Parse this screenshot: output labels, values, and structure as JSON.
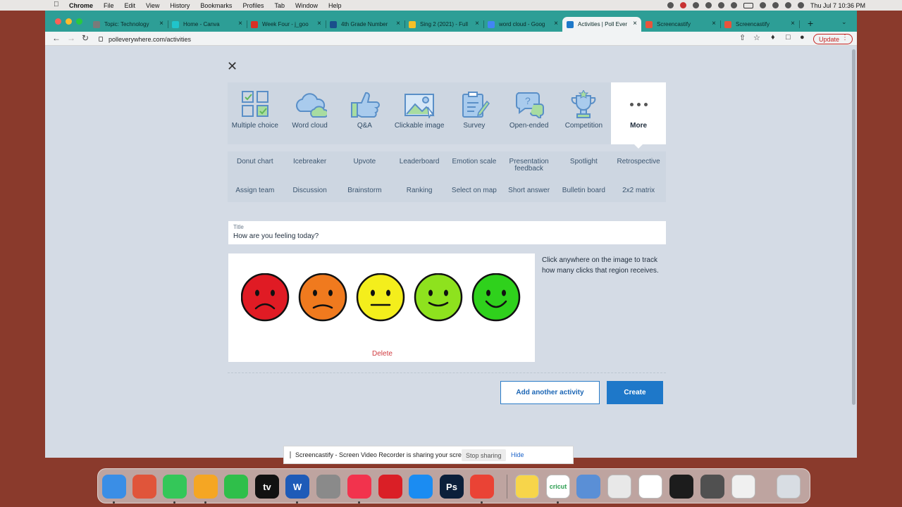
{
  "menubar": {
    "menus": [
      "Chrome",
      "File",
      "Edit",
      "View",
      "History",
      "Bookmarks",
      "Profiles",
      "Tab",
      "Window",
      "Help"
    ],
    "clock": "Thu Jul 7  10:36 PM"
  },
  "browser": {
    "tabs": [
      {
        "title": "Topic: Technology",
        "favicon_color": "#7a7a7a"
      },
      {
        "title": "Home - Canva",
        "favicon_color": "#20c4cb"
      },
      {
        "title": "Week Four - j_goo",
        "favicon_color": "#d93025"
      },
      {
        "title": "4th Grade Number",
        "favicon_color": "#1a4f8b"
      },
      {
        "title": "Sing 2 (2021) - Full",
        "favicon_color": "#f6c026"
      },
      {
        "title": "word cloud - Goog",
        "favicon_color": "#4285f4"
      },
      {
        "title": "Activities | Poll Ever",
        "favicon_color": "#1e78c9"
      },
      {
        "title": "Screencastify",
        "favicon_color": "#e8543c"
      },
      {
        "title": "Screencastify",
        "favicon_color": "#e8543c"
      }
    ],
    "url": "polleverywhere.com/activities",
    "update_label": "Update"
  },
  "activity_types": [
    {
      "label": "Multiple choice",
      "icon": "multiple-choice-icon"
    },
    {
      "label": "Word cloud",
      "icon": "word-cloud-icon"
    },
    {
      "label": "Q&A",
      "icon": "thumbs-up-icon"
    },
    {
      "label": "Clickable image",
      "icon": "clickable-image-icon"
    },
    {
      "label": "Survey",
      "icon": "clipboard-icon"
    },
    {
      "label": "Open-ended",
      "icon": "speech-bubbles-icon"
    },
    {
      "label": "Competition",
      "icon": "trophy-icon"
    },
    {
      "label": "More",
      "icon": "more-dots-icon"
    }
  ],
  "more_types": [
    "Donut chart",
    "Icebreaker",
    "Upvote",
    "Leaderboard",
    "Emotion scale",
    "Presentation feedback",
    "Spotlight",
    "Retrospective",
    "Assign team",
    "Discussion",
    "Brainstorm",
    "Ranking",
    "Select on map",
    "Short answer",
    "Bulletin board",
    "2x2 matrix"
  ],
  "form": {
    "title_label": "Title",
    "title_value": "How are you feeling today?",
    "delete_label": "Delete",
    "hint": "Click anywhere on the image to track how many clicks that region receives."
  },
  "emotion_faces": [
    {
      "color": "#e01b24",
      "mood": "sad"
    },
    {
      "color": "#f07a1e",
      "mood": "unhappy"
    },
    {
      "color": "#f4ee1c",
      "mood": "neutral"
    },
    {
      "color": "#8ee21e",
      "mood": "content"
    },
    {
      "color": "#2fd11c",
      "mood": "happy"
    }
  ],
  "actions": {
    "add_another": "Add another activity",
    "create": "Create"
  },
  "share_bar": {
    "message": "Screencastify - Screen Video Recorder is sharing your screen.",
    "stop": "Stop sharing",
    "hide": "Hide"
  },
  "dock": [
    {
      "name": "finder-icon",
      "color": "#3a8ee6"
    },
    {
      "name": "launchpad-icon",
      "color": "#e0553a"
    },
    {
      "name": "messages-icon",
      "color": "#34c759"
    },
    {
      "name": "photos-icon",
      "color": "#f5a623"
    },
    {
      "name": "facetime-icon",
      "color": "#2fbf4a"
    },
    {
      "name": "apple-tv-icon",
      "color": "#111111",
      "text": "tv"
    },
    {
      "name": "word-icon",
      "color": "#1e5bb8",
      "text": "W"
    },
    {
      "name": "system-preferences-icon",
      "color": "#8a8a8a"
    },
    {
      "name": "music-icon",
      "color": "#f2334d"
    },
    {
      "name": "creative-cloud-icon",
      "color": "#da1f26"
    },
    {
      "name": "app-store-icon",
      "color": "#1b8cf2"
    },
    {
      "name": "photoshop-icon",
      "color": "#0b1f3a",
      "text": "Ps"
    },
    {
      "name": "chrome-icon",
      "color": "#ea4335"
    },
    {
      "name": "notes-icon",
      "color": "#f7d54a"
    },
    {
      "name": "cricut-icon",
      "color": "#ffffff",
      "text": "cricut"
    },
    {
      "name": "preview-icon",
      "color": "#5a8fd6"
    },
    {
      "name": "window-thumbnail-1-icon",
      "color": "#e8e8e8"
    },
    {
      "name": "window-thumbnail-2-icon",
      "color": "#ffffff"
    },
    {
      "name": "window-thumbnail-3-icon",
      "color": "#1c1c1c"
    },
    {
      "name": "window-thumbnail-4-icon",
      "color": "#505050"
    },
    {
      "name": "window-thumbnail-5-icon",
      "color": "#f0f0f0"
    },
    {
      "name": "trash-icon",
      "color": "#d8dde3"
    }
  ]
}
